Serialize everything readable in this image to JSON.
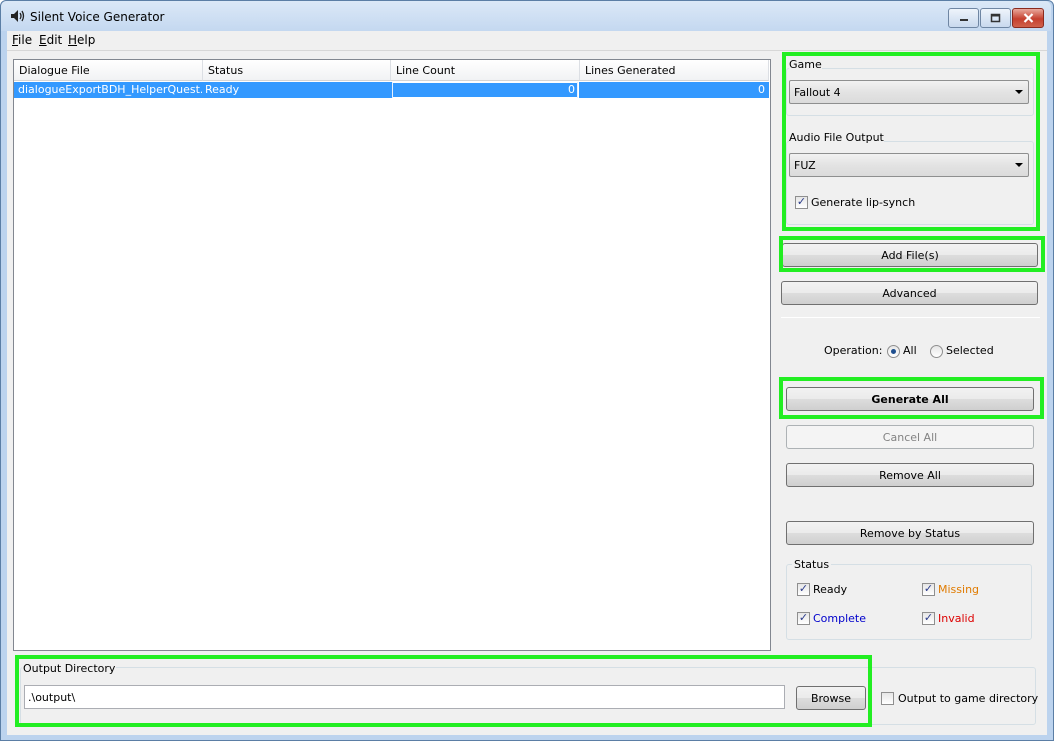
{
  "window": {
    "title": "Silent Voice Generator",
    "title_icon": "speaker-icon",
    "caption_buttons": [
      "minimize-icon",
      "restore-icon",
      "close-icon"
    ]
  },
  "menu": [
    {
      "label": "File",
      "mnemonic": "F",
      "rest": "ile"
    },
    {
      "label": "Edit",
      "mnemonic": "E",
      "rest": "dit"
    },
    {
      "label": "Help",
      "mnemonic": "H",
      "rest": "elp"
    }
  ],
  "list": {
    "columns": [
      "Dialogue File",
      "Status",
      "Line Count",
      "Lines Generated"
    ],
    "rows": [
      {
        "file": "dialogueExportBDH_HelperQuest.txt",
        "status": "Ready",
        "line_count": "0",
        "lines_generated": "0",
        "selected": true
      }
    ]
  },
  "game": {
    "label": "Game",
    "selected": "Fallout 4"
  },
  "audio": {
    "label": "Audio File Output",
    "selected": "FUZ",
    "lip_sync": {
      "label": "Generate lip-synch",
      "checked": true
    }
  },
  "buttons": {
    "add_files": "Add File(s)",
    "advanced": "Advanced",
    "generate_all": "Generate All",
    "cancel_all": "Cancel All",
    "remove_all": "Remove All",
    "remove_by_status": "Remove by Status",
    "browse": "Browse"
  },
  "operation": {
    "label": "Operation:",
    "options": [
      "All",
      "Selected"
    ],
    "selected": "All"
  },
  "status_filter": {
    "label": "Status",
    "items": [
      {
        "label": "Ready",
        "color": "#000000",
        "checked": true
      },
      {
        "label": "Missing",
        "color": "#e07b00",
        "checked": true
      },
      {
        "label": "Complete",
        "color": "#0000cc",
        "checked": true
      },
      {
        "label": "Invalid",
        "color": "#dd0000",
        "checked": true
      }
    ]
  },
  "output": {
    "label": "Output Directory",
    "value": ".\\output\\",
    "game_dir": {
      "label": "Output to game directory",
      "checked": false
    }
  },
  "colors": {
    "highlight": "#22ee22",
    "selection": "#3399ff"
  }
}
